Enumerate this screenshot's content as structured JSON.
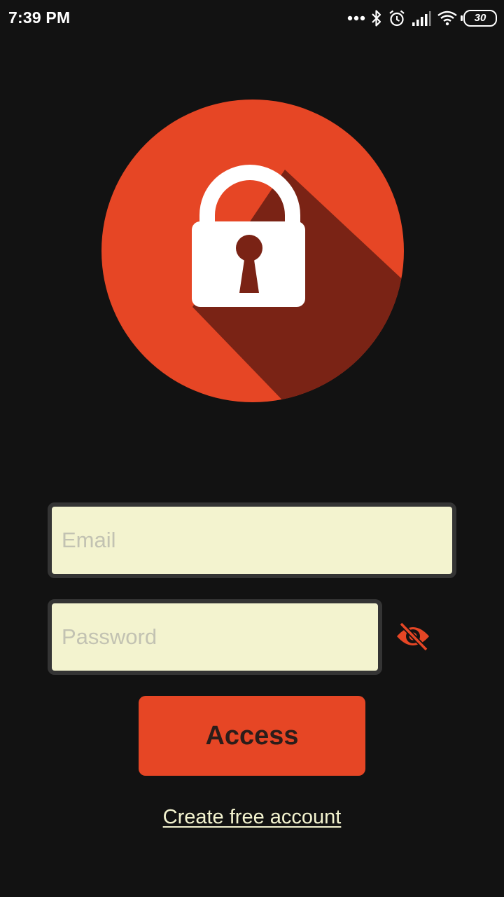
{
  "status_bar": {
    "time": "7:39 PM",
    "battery_level": "30",
    "icons": [
      "more-dots-icon",
      "bluetooth-icon",
      "alarm-icon",
      "signal-icon",
      "wifi-icon",
      "battery-icon"
    ]
  },
  "logo": {
    "icon": "padlock-icon",
    "circle_color": "#e64625",
    "shadow_color": "#7a2315",
    "lock_color": "#ffffff"
  },
  "form": {
    "email": {
      "placeholder": "Email",
      "value": ""
    },
    "password": {
      "placeholder": "Password",
      "value": ""
    },
    "password_toggle_icon": "eye-off-icon",
    "access_label": "Access",
    "create_account_label": "Create free account"
  },
  "colors": {
    "background": "#121212",
    "accent": "#e64625",
    "field_background": "#f3f3cf",
    "field_border": "#343434",
    "link": "#f3f3cf"
  }
}
